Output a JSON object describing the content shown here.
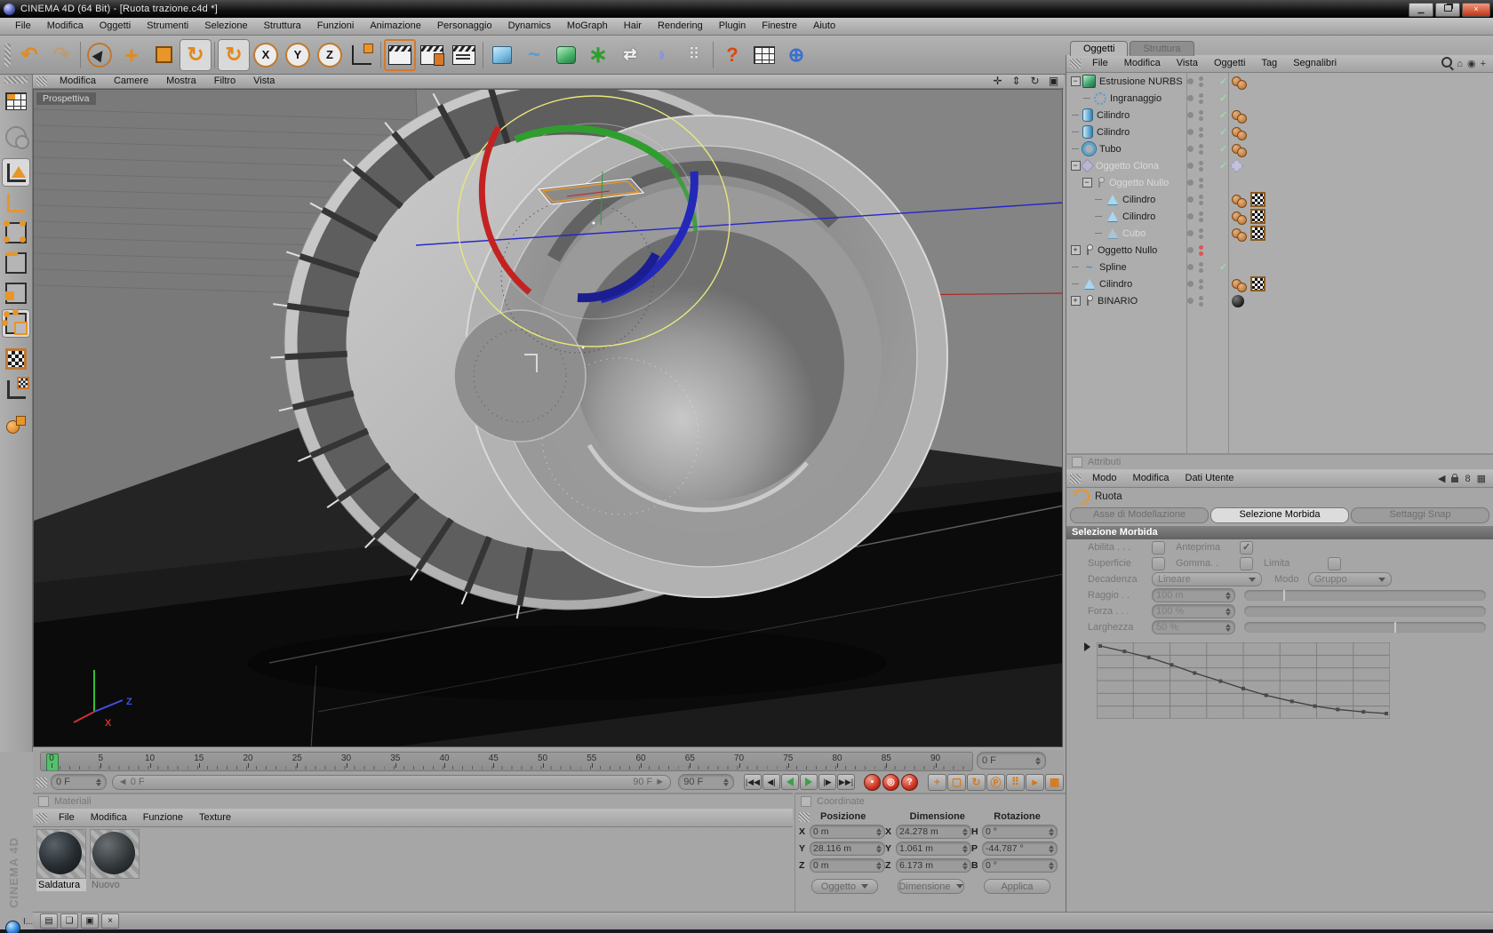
{
  "window": {
    "title": "CINEMA 4D (64 Bit) - [Ruota trazione.c4d *]",
    "controls": [
      "minimize",
      "restore",
      "close"
    ]
  },
  "menubar": [
    "File",
    "Modifica",
    "Oggetti",
    "Strumenti",
    "Selezione",
    "Struttura",
    "Funzioni",
    "Animazione",
    "Personaggio",
    "Dynamics",
    "MoGraph",
    "Hair",
    "Rendering",
    "Plugin",
    "Finestre",
    "Aiuto"
  ],
  "toolbar": [
    {
      "name": "undo"
    },
    {
      "name": "redo",
      "disabled": true
    },
    {
      "name": "live-selection",
      "sep": true
    },
    {
      "name": "move"
    },
    {
      "name": "scale"
    },
    {
      "name": "rotate",
      "active": true
    },
    {
      "name": "last-tool-rotate",
      "active": true,
      "sep": true
    },
    {
      "name": "lock-x",
      "letter": "X"
    },
    {
      "name": "lock-y",
      "letter": "Y"
    },
    {
      "name": "lock-z",
      "letter": "Z"
    },
    {
      "name": "coordinate-system"
    },
    {
      "name": "render-view",
      "highlight": true,
      "sep": true
    },
    {
      "name": "render-picture-viewer"
    },
    {
      "name": "render-settings"
    },
    {
      "name": "add-primitive",
      "sep": true
    },
    {
      "name": "add-spline"
    },
    {
      "name": "add-nurbs"
    },
    {
      "name": "add-mograph"
    },
    {
      "name": "add-symmetry"
    },
    {
      "name": "add-deformer"
    },
    {
      "name": "add-particles"
    },
    {
      "name": "help",
      "sep": true
    },
    {
      "name": "xpresso"
    },
    {
      "name": "online-help"
    }
  ],
  "left_toolbar": [
    {
      "name": "make-editable"
    },
    {
      "name": "use-world-system",
      "disabled": true
    },
    {
      "name": "model-mode",
      "active": true
    },
    {
      "name": "object-axis-mode"
    },
    {
      "name": "point-mode"
    },
    {
      "name": "edge-mode"
    },
    {
      "name": "polygon-mode"
    },
    {
      "name": "uv-mode",
      "active": true
    },
    {
      "name": "texture-mode"
    },
    {
      "name": "texture-axis-mode"
    },
    {
      "name": "selection-filter"
    }
  ],
  "viewport": {
    "menu": [
      "Modifica",
      "Camere",
      "Mostra",
      "Filtro",
      "Vista"
    ],
    "label": "Prospettiva",
    "view_icons": [
      "pan-view",
      "zoom-view",
      "rotate-view",
      "toggle-views"
    ]
  },
  "object_manager": {
    "tabs": [
      {
        "label": "Oggetti",
        "active": true
      },
      {
        "label": "Struttura",
        "active": false
      }
    ],
    "menu": [
      "File",
      "Modifica",
      "Vista",
      "Oggetti",
      "Tag",
      "Segnalibri"
    ],
    "menu_icons": [
      "search",
      "home",
      "target",
      "add"
    ],
    "tree": [
      {
        "label": "Estrusione NURBS",
        "icon": "extrude",
        "depth": 0,
        "toggle": "minus",
        "check": true,
        "tags": [
          "spheres"
        ]
      },
      {
        "label": "Ingranaggio",
        "icon": "gear",
        "depth": 1,
        "toggle": "elbow",
        "check": true,
        "tags": []
      },
      {
        "label": "Cilindro",
        "icon": "cylinder",
        "depth": 0,
        "toggle": "line",
        "check": true,
        "tags": [
          "spheres"
        ]
      },
      {
        "label": "Cilindro",
        "icon": "cylinder",
        "depth": 0,
        "toggle": "line",
        "check": true,
        "tags": [
          "spheres"
        ]
      },
      {
        "label": "Tubo",
        "icon": "tube",
        "depth": 0,
        "toggle": "line",
        "check": true,
        "tags": [
          "spheres"
        ]
      },
      {
        "label": "Oggetto Clona",
        "icon": "clone",
        "depth": 0,
        "toggle": "minus",
        "check": true,
        "grayed": true,
        "tags": [
          "clone"
        ]
      },
      {
        "label": "Oggetto Nullo",
        "icon": "null",
        "depth": 1,
        "toggle": "minus",
        "grayed": true,
        "tags": []
      },
      {
        "label": "Cilindro",
        "icon": "poly",
        "depth": 2,
        "toggle": "line",
        "tags": [
          "spheres",
          "texture"
        ]
      },
      {
        "label": "Cilindro",
        "icon": "poly",
        "depth": 2,
        "toggle": "line",
        "tags": [
          "spheres",
          "texture"
        ]
      },
      {
        "label": "Cubo",
        "icon": "poly",
        "depth": 2,
        "toggle": "line",
        "grayed": true,
        "tags": [
          "spheres",
          "texture"
        ]
      },
      {
        "label": "Oggetto Nullo",
        "icon": "null",
        "depth": 0,
        "toggle": "plus",
        "dots": "red",
        "tags": []
      },
      {
        "label": "Spline",
        "icon": "spline",
        "depth": 0,
        "toggle": "line",
        "check": true,
        "tags": []
      },
      {
        "label": "Cilindro",
        "icon": "poly",
        "depth": 0,
        "toggle": "line",
        "tags": [
          "spheres",
          "texture"
        ]
      },
      {
        "label": "BINARIO",
        "icon": "null",
        "depth": 0,
        "toggle": "plus",
        "tags": [
          "material"
        ]
      }
    ]
  },
  "attributes": {
    "title": "Attributi",
    "menu": [
      "Modo",
      "Modifica",
      "Dati Utente"
    ],
    "object_label": "Ruota",
    "tabs": [
      {
        "label": "Asse di Modellazione",
        "active": false
      },
      {
        "label": "Selezione Morbida",
        "active": true
      },
      {
        "label": "Settaggi Snap",
        "active": false
      }
    ],
    "section": "Selezione Morbida",
    "check_rows": [
      [
        {
          "label": "Abilita . . .",
          "checked": false
        },
        {
          "label": "Anteprima",
          "checked": true
        }
      ],
      [
        {
          "label": "Superficie",
          "checked": false
        },
        {
          "label": "Gomma. .",
          "checked": false
        },
        {
          "label": "Limita",
          "checked": false
        }
      ]
    ],
    "dropdowns": [
      {
        "label": "Decadenza",
        "value": "Lineare",
        "width": 110
      },
      {
        "label": "Modo",
        "value": "Gruppo",
        "width": 80
      }
    ],
    "sliders": [
      {
        "label": "Raggio . .",
        "value": "100 m",
        "handle": 0.16
      },
      {
        "label": "Forza . . .",
        "value": "100 %",
        "handle": null
      },
      {
        "label": "Larghezza",
        "value": "50 %",
        "handle": 0.62
      }
    ],
    "falloff_curve_points": [
      [
        0,
        0
      ],
      [
        0.085,
        0.08
      ],
      [
        0.17,
        0.17
      ],
      [
        0.25,
        0.28
      ],
      [
        0.33,
        0.4
      ],
      [
        0.42,
        0.52
      ],
      [
        0.5,
        0.63
      ],
      [
        0.58,
        0.73
      ],
      [
        0.67,
        0.82
      ],
      [
        0.75,
        0.89
      ],
      [
        0.83,
        0.94
      ],
      [
        0.92,
        0.975
      ],
      [
        1,
        1
      ]
    ]
  },
  "timeline": {
    "ticks": [
      0,
      5,
      10,
      15,
      20,
      25,
      30,
      35,
      40,
      45,
      50,
      55,
      60,
      65,
      70,
      75,
      80,
      85,
      90
    ],
    "marker_frame": 0,
    "end_spinner": "0 F",
    "current_frame": "0 F",
    "range_left": "◄ 0 F",
    "range_right": "90 F ►",
    "end_frame": "90 F",
    "transport": [
      "go-start",
      "prev-key",
      "play-backward",
      "play-forward",
      "next-key",
      "go-end"
    ],
    "record_buttons": [
      "record-keyframe",
      "autokey",
      "keying-help"
    ],
    "key_toggles": [
      "record-position",
      "record-scale",
      "record-rotation",
      "record-parameter",
      "record-pla",
      "keyframe-selection",
      "keyframe-presets"
    ]
  },
  "materials": {
    "title": "Materiali",
    "menu": [
      "File",
      "Modifica",
      "Funzione",
      "Texture"
    ],
    "items": [
      {
        "name": "Saldatura",
        "selected": true,
        "preview": "textured"
      },
      {
        "name": "Nuovo",
        "selected": false,
        "preview": "smooth"
      }
    ]
  },
  "coordinates": {
    "title": "Coordinate",
    "columns": [
      "Posizione",
      "Dimensione",
      "Rotazione"
    ],
    "rows": [
      {
        "pos_axis": "X",
        "pos": "0 m",
        "dim_axis": "X",
        "dim": "24.278 m",
        "rot_axis": "H",
        "rot": "0 °"
      },
      {
        "pos_axis": "Y",
        "pos": "28.116 m",
        "dim_axis": "Y",
        "dim": "1.061 m",
        "rot_axis": "P",
        "rot": "-44.787 °"
      },
      {
        "pos_axis": "Z",
        "pos": "0 m",
        "dim_axis": "Z",
        "dim": "6.173 m",
        "rot_axis": "B",
        "rot": "0 °"
      }
    ],
    "buttons": [
      {
        "label": "Oggetto",
        "type": "dropdown"
      },
      {
        "label": "Dimensione",
        "type": "dropdown"
      },
      {
        "label": "Applica",
        "type": "button"
      }
    ]
  },
  "bottom": {
    "brand_vertical": "CINEMA 4D",
    "taskbar_label": "I...",
    "window_buttons": [
      "doc",
      "restore",
      "maximize",
      "close"
    ]
  },
  "colors": {
    "accent_orange": "#e8952a",
    "green_check": "#8fe0a8",
    "timeline_marker": "#55c06a",
    "gizmo_red": "#c42222",
    "gizmo_green": "#2f9e2f",
    "gizmo_blue": "#2428b8",
    "gizmo_yellow": "#e8e87a"
  }
}
